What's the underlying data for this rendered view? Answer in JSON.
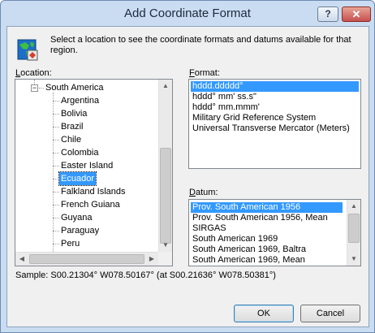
{
  "window": {
    "title": "Add Coordinate Format",
    "help_button": "?",
    "close_button": "✕"
  },
  "intro_text": "Select a location to see the coordinate formats and datums available for that region.",
  "location": {
    "label_accel": "L",
    "label_rest": "ocation:",
    "parent": "South America",
    "expander": "−",
    "items": [
      "Argentina",
      "Bolivia",
      "Brazil",
      "Chile",
      "Colombia",
      "Easter Island",
      "Ecuador",
      "Falkland Islands",
      "French Guiana",
      "Guyana",
      "Paraguay",
      "Peru"
    ],
    "selected": "Ecuador"
  },
  "format": {
    "label_accel": "F",
    "label_rest": "ormat:",
    "items": [
      "hddd.ddddd°",
      "hddd° mm' ss.s\"",
      "hddd° mm.mmm'",
      "Military Grid Reference System",
      "Universal Transverse Mercator (Meters)"
    ],
    "selected_index": 0
  },
  "datum": {
    "label_accel": "D",
    "label_rest": "atum:",
    "items": [
      "Prov. South American 1956",
      "Prov. South American 1956, Mean",
      "SIRGAS",
      "South American 1969",
      "South American 1969, Baltra",
      "South American 1969, Mean"
    ],
    "selected_index": 0
  },
  "sample_text": "Sample: S00.21304°  W078.50167° (at S00.21636°  W078.50381°)",
  "buttons": {
    "ok": "OK",
    "cancel": "Cancel"
  },
  "icons": {
    "app": "globe-map-icon",
    "scroll_up": "arrow-up-icon",
    "scroll_down": "arrow-down-icon",
    "scroll_left": "arrow-left-icon",
    "scroll_right": "arrow-right-icon"
  },
  "colors": {
    "selection": "#3399ff",
    "frame": "#c9dcf2",
    "close": "#c75050"
  }
}
